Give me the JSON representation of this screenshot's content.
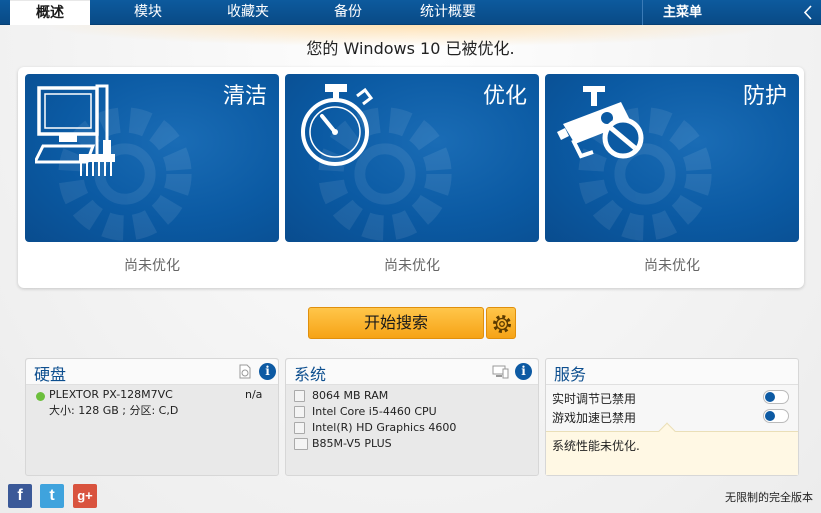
{
  "nav": {
    "tabs": [
      {
        "label": "概述",
        "active": true
      },
      {
        "label": "模块",
        "active": false
      },
      {
        "label": "收藏夹",
        "active": false
      },
      {
        "label": "备份",
        "active": false
      },
      {
        "label": "统计概要",
        "active": false
      }
    ],
    "main_menu_label": "主菜单"
  },
  "headline": "您的 Windows 10 已被优化.",
  "tiles": [
    {
      "title": "清洁",
      "status": "尚未优化",
      "icon": "computer-cleaning-icon"
    },
    {
      "title": "优化",
      "status": "尚未优化",
      "icon": "stopwatch-icon"
    },
    {
      "title": "防护",
      "status": "尚未优化",
      "icon": "blocked-camera-icon"
    }
  ],
  "actions": {
    "start_label": "开始搜索",
    "settings_icon": "gear-icon"
  },
  "disk": {
    "title": "硬盘",
    "drive_name": "PLEXTOR PX-128M7VC",
    "drive_value": "n/a",
    "drive_detail": "大小: 128 GB ; 分区: C,D"
  },
  "system": {
    "title": "系统",
    "items": [
      "8064 MB RAM",
      "Intel Core i5-4460 CPU",
      "Intel(R) HD Graphics 4600",
      "B85M-V5 PLUS"
    ]
  },
  "services": {
    "title": "服务",
    "items": [
      "实时调节已禁用",
      "游戏加速已禁用"
    ],
    "note": "系统性能未优化."
  },
  "footer": {
    "social": [
      {
        "glyph": "f",
        "icon": "facebook-icon",
        "color": "#3b5998"
      },
      {
        "glyph": "t",
        "icon": "twitter-icon",
        "color": "#3fa3dd"
      },
      {
        "glyph": "g+",
        "icon": "google-plus-icon",
        "color": "#d9533e"
      }
    ],
    "edition": "无限制的完全版本"
  },
  "colors": {
    "accent": "#0b5aa3",
    "button": "#f6a316"
  }
}
